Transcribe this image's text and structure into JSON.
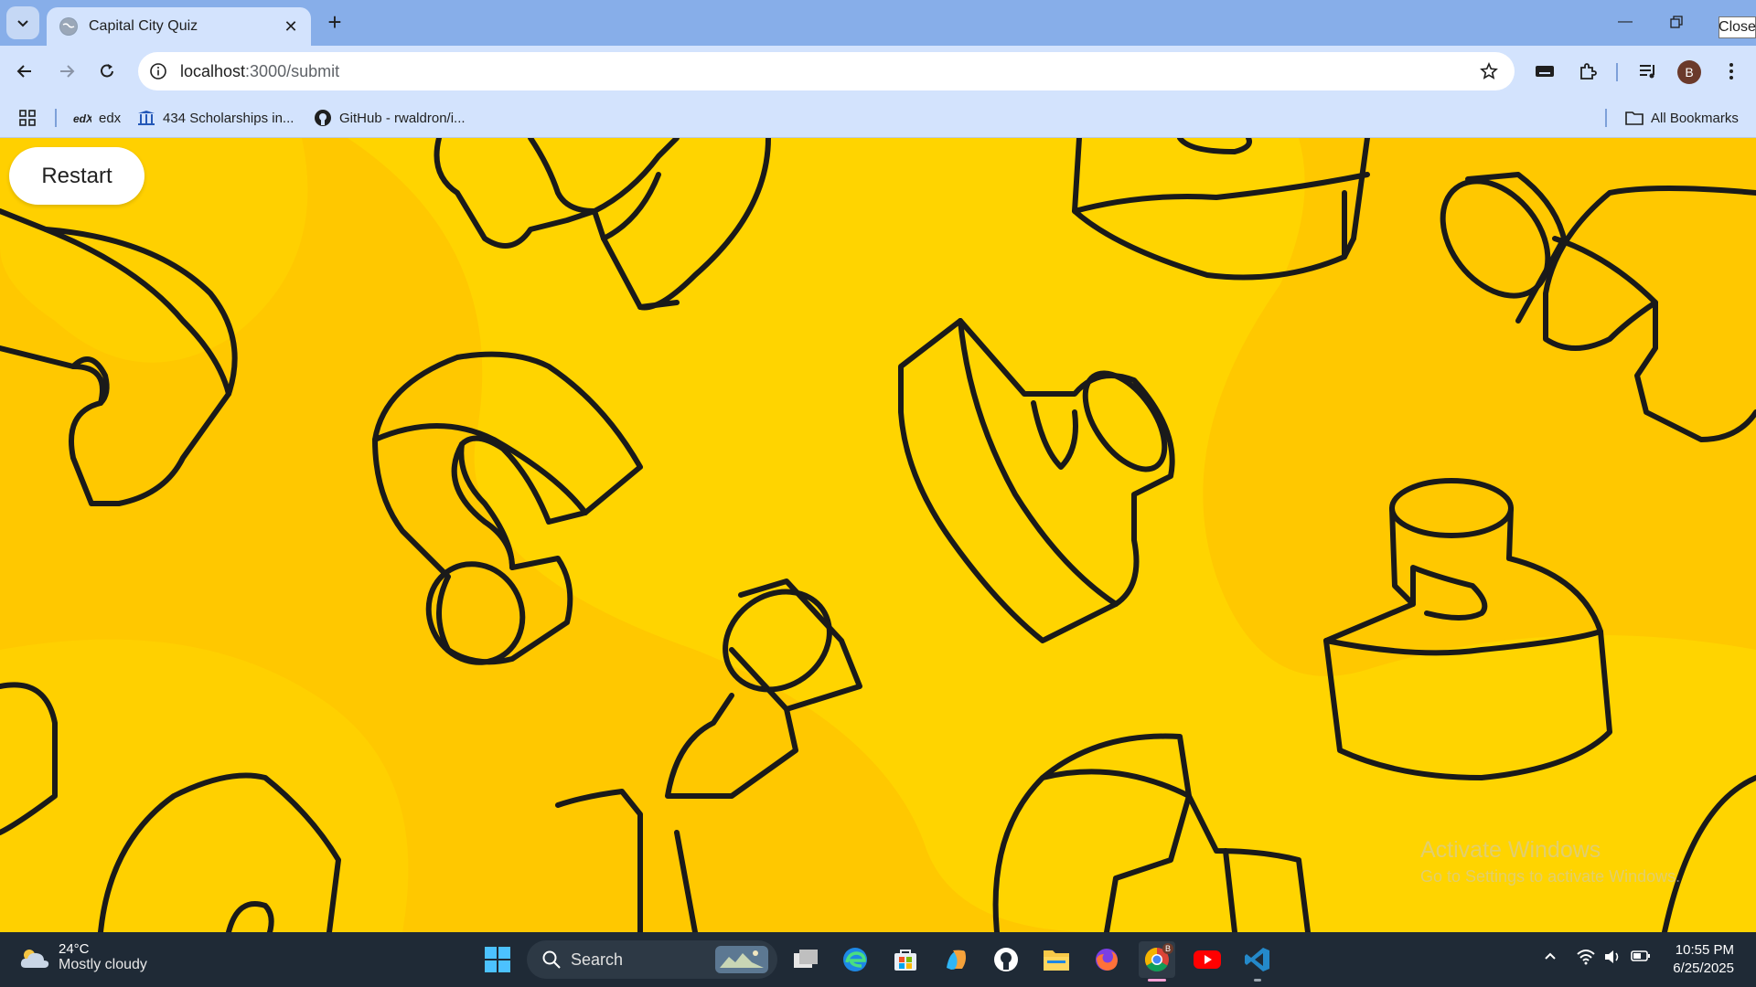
{
  "browser": {
    "tab_title": "Capital City Quiz",
    "url_host": "localhost",
    "url_path": ":3000/submit",
    "close_tooltip": "Close",
    "profile_initial": "B"
  },
  "bookmarks": {
    "items": [
      {
        "label": "edx",
        "icon": "edx-icon"
      },
      {
        "label": "434 Scholarships in...",
        "icon": "scholarship-icon"
      },
      {
        "label": "GitHub - rwaldron/i...",
        "icon": "github-icon"
      }
    ],
    "all_bookmarks": "All Bookmarks"
  },
  "page": {
    "restart_label": "Restart",
    "background_color": "#ffc800",
    "accent_color": "#ffd400"
  },
  "watermark": {
    "line1": "Activate Windows",
    "line2": "Go to Settings to activate Windows."
  },
  "taskbar": {
    "weather_temp": "24°C",
    "weather_desc": "Mostly cloudy",
    "search_label": "Search",
    "time": "10:55 PM",
    "date": "6/25/2025",
    "chrome_badge": "B"
  }
}
